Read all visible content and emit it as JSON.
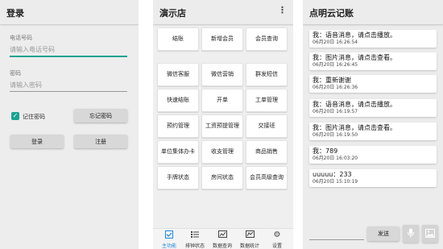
{
  "login": {
    "title": "登录",
    "phone_label": "电话号码",
    "phone_placeholder": "请输入电话号码",
    "password_label": "密码",
    "password_placeholder": "请输入密码",
    "remember_label": "记住密码",
    "remember_checked": true,
    "forgot_label": "忘记密码",
    "login_label": "登录",
    "register_label": "注册",
    "accent_color": "#19a392"
  },
  "shop": {
    "title": "演示店",
    "menu_icon": "more-vert-icon",
    "tiles": [
      "结账",
      "新增会员",
      "会员查询",
      "微信客服",
      "微信营销",
      "群发短信",
      "快速结账",
      "开单",
      "工单管理",
      "预约管理",
      "工资预提管理",
      "交接班",
      "单位集体办卡",
      "收支管理",
      "商品销售",
      "手牌状态",
      "房间状态",
      "会员高级查询"
    ],
    "nav": [
      {
        "label": "主功能",
        "icon": "check-square-icon",
        "active": true
      },
      {
        "label": "排钟状态",
        "icon": "list-icon",
        "active": false
      },
      {
        "label": "数据查询",
        "icon": "chart-icon",
        "active": false
      },
      {
        "label": "数据统计",
        "icon": "chart-icon",
        "active": false
      },
      {
        "label": "设置",
        "icon": "gear-icon",
        "active": false
      }
    ],
    "active_color": "#1e88e5"
  },
  "chat": {
    "title": "点明云记账",
    "messages": [
      {
        "text": "我：语音消息，请点击播放。",
        "time": "06月20日 16:26:54"
      },
      {
        "text": "我：图片消息，请点击查看。",
        "time": "06月20日 16:26:45"
      },
      {
        "text": "我：重新谢谢",
        "time": "06月20日 16:26:36"
      },
      {
        "text": "我：语音消息，请点击播放。",
        "time": "06月20日 16:19:57"
      },
      {
        "text": "我：图片消息，请点击查看。",
        "time": "06月20日 16:19:50"
      },
      {
        "text": "我：789",
        "time": "06月20日 16:03:20"
      },
      {
        "text": "uuuuu：233",
        "time": "06月20日 15:10:19"
      }
    ],
    "input_value": "",
    "send_label": "发送",
    "mic_icon": "mic-icon",
    "image_icon": "image-icon"
  }
}
